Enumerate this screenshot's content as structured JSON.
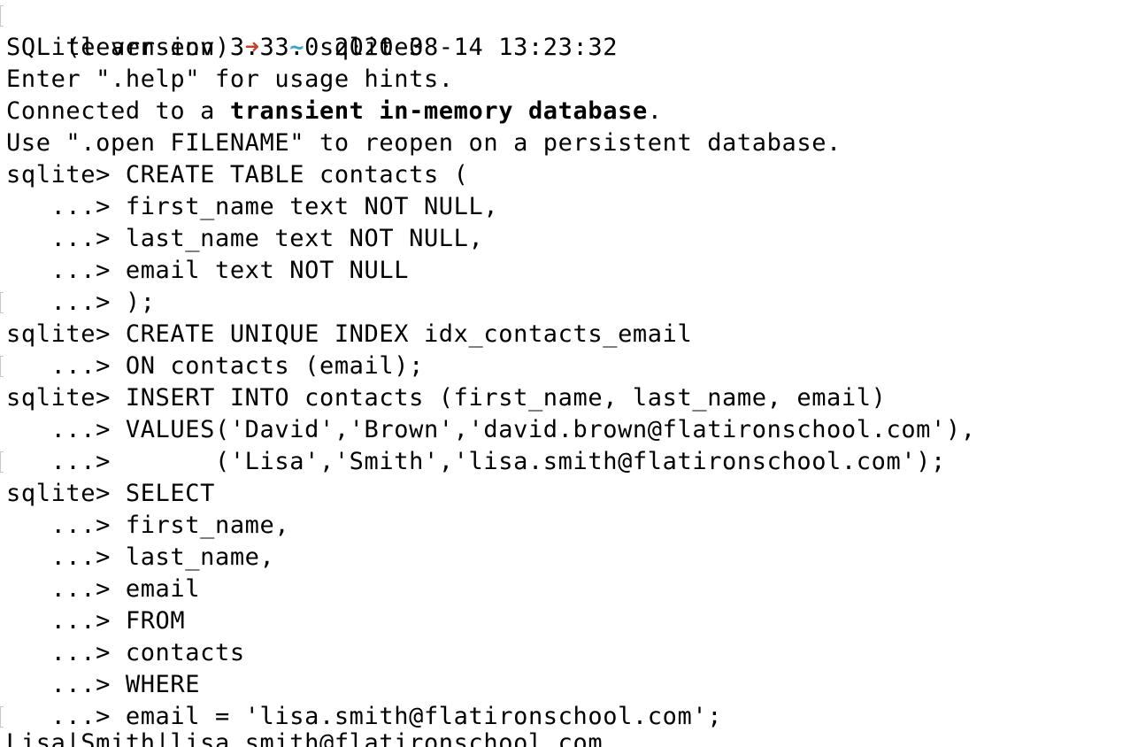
{
  "shell_prompt": {
    "env": "(learn-env)",
    "arrow": "➜",
    "dir": "~",
    "command": "sqlite3"
  },
  "banner": {
    "version": "SQLite version 3.33.0 2020-08-14 13:23:32",
    "help": "Enter \".help\" for usage hints.",
    "connected_prefix": "Connected to a ",
    "connected_bold": "transient in-memory database",
    "connected_suffix": ".",
    "open_hint": "Use \".open FILENAME\" to reopen on a persistent database."
  },
  "session": [
    {
      "prompt": "sqlite> ",
      "text": "CREATE TABLE contacts (",
      "mark": false
    },
    {
      "prompt": "   ...> ",
      "text": "first_name text NOT NULL,",
      "mark": false
    },
    {
      "prompt": "   ...> ",
      "text": "last_name text NOT NULL,",
      "mark": false
    },
    {
      "prompt": "   ...> ",
      "text": "email text NOT NULL",
      "mark": false
    },
    {
      "prompt": "   ...> ",
      "text": ");",
      "mark": true
    },
    {
      "prompt": "sqlite> ",
      "text": "CREATE UNIQUE INDEX idx_contacts_email",
      "mark": false
    },
    {
      "prompt": "   ...> ",
      "text": "ON contacts (email);",
      "mark": true
    },
    {
      "prompt": "sqlite> ",
      "text": "INSERT INTO contacts (first_name, last_name, email)",
      "mark": false
    },
    {
      "prompt": "   ...> ",
      "text": "VALUES('David','Brown','david.brown@flatironschool.com'),",
      "mark": false
    },
    {
      "prompt": "   ...> ",
      "text": "      ('Lisa','Smith','lisa.smith@flatironschool.com');",
      "mark": true
    },
    {
      "prompt": "sqlite> ",
      "text": "SELECT",
      "mark": false
    },
    {
      "prompt": "   ...> ",
      "text": "first_name,",
      "mark": false
    },
    {
      "prompt": "   ...> ",
      "text": "last_name,",
      "mark": false
    },
    {
      "prompt": "   ...> ",
      "text": "email",
      "mark": false
    },
    {
      "prompt": "   ...> ",
      "text": "FROM",
      "mark": false
    },
    {
      "prompt": "   ...> ",
      "text": "contacts",
      "mark": false
    },
    {
      "prompt": "   ...> ",
      "text": "WHERE",
      "mark": false
    },
    {
      "prompt": "   ...> ",
      "text": "email = 'lisa.smith@flatironschool.com';",
      "mark": true
    }
  ],
  "result_line": "Lisa|Smith|lisa.smith@flatironschool.com"
}
